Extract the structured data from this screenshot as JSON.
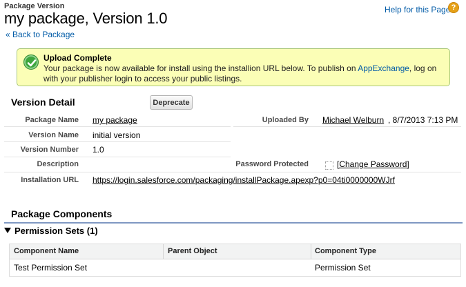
{
  "header": {
    "eyebrow": "Package Version",
    "title": "my package, Version 1.0",
    "help_link": "Help for this Page",
    "help_icon": "?",
    "back_link": "« Back to Package"
  },
  "alert": {
    "title": "Upload Complete",
    "message_before": "Your package is now available for install using the installion URL below. To publish on ",
    "message_link": "AppExchange",
    "message_after": ", log on with your publisher login to access your public listings.",
    "icon": "check-circle-icon",
    "colors": {
      "background": "#fbfeb6",
      "border": "#a8c77a",
      "check": "#3da53d"
    }
  },
  "version_detail": {
    "title": "Version Detail",
    "deprecate_label": "Deprecate",
    "package_name_label": "Package Name",
    "package_name_value": "my package",
    "uploaded_by_label": "Uploaded By",
    "uploaded_by_value": "Michael Welburn",
    "uploaded_date": ", 8/7/2013 7:13 PM",
    "version_name_label": "Version Name",
    "version_name_value": "initial version",
    "version_number_label": "Version Number",
    "version_number_value": "1.0",
    "description_label": "Description",
    "password_label": "Password Protected",
    "change_password_link": "[Change Password]",
    "install_url_label": "Installation URL",
    "install_url_value": "https://login.salesforce.com/packaging/installPackage.apexp?p0=04ti0000000WJrf"
  },
  "components": {
    "title": "Package Components",
    "permission_sets_header": "Permission Sets (1)",
    "columns": [
      "Component Name",
      "Parent Object",
      "Component Type"
    ],
    "rows": [
      [
        "Test Permission Set",
        "",
        "Permission Set"
      ]
    ]
  },
  "colors": {
    "link": "#015ba7",
    "section_rule": "#7f97c2",
    "help_icon": "#e6a117"
  }
}
